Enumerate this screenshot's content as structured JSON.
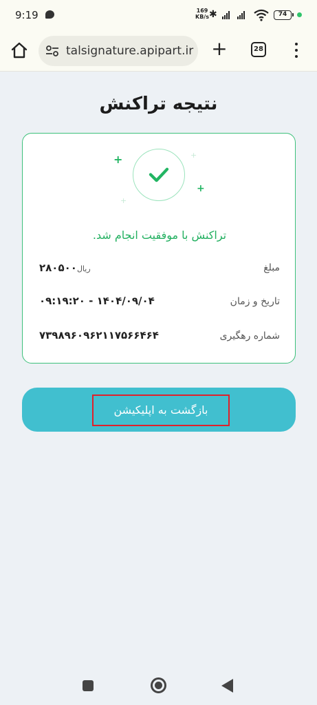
{
  "status_bar": {
    "time": "9:19",
    "net_speed_value": "169",
    "net_speed_unit": "KB/s",
    "battery": "74"
  },
  "browser": {
    "url": "talsignature.apipart.ir",
    "tab_count": "28"
  },
  "page": {
    "title": "نتیجه تراکنش",
    "success_message": "تراکنش با موفقیت انجام شد.",
    "rows": [
      {
        "label": "مبلغ",
        "value": "۲۸۰۵۰۰",
        "currency": "ریال"
      },
      {
        "label": "تاریخ و زمان",
        "value": "۰۹:۱۹:۲۰ - ۱۴۰۴/۰۹/۰۴"
      },
      {
        "label": "شماره رهگیری",
        "value": "۷۳۹۸۹۶۰۹۶۲۱۱۷۵۶۶۴۶۴"
      }
    ],
    "return_button_label": "بازگشت به اپلیکیشن"
  },
  "colors": {
    "success": "#22b060",
    "button_bg": "#41bfcf",
    "highlight": "#e0202a"
  }
}
